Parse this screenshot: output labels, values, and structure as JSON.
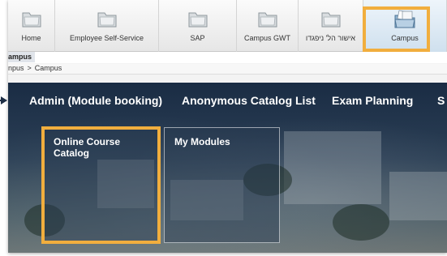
{
  "toolbar": {
    "items": [
      {
        "label": "Home",
        "icon": "folder-icon"
      },
      {
        "label": "Employee Self-Service",
        "icon": "folder-icon"
      },
      {
        "label": "SAP",
        "icon": "folder-icon"
      },
      {
        "label": "Campus GWT",
        "icon": "folder-icon"
      },
      {
        "label": "אישור הל' ניפגדו",
        "icon": "folder-icon"
      },
      {
        "label": "Campus",
        "icon": "folder-open-papers-icon"
      }
    ],
    "active_index": 5
  },
  "page": {
    "subtitle": "ampus",
    "breadcrumb": [
      "npus",
      ">",
      "Campus"
    ]
  },
  "nav": {
    "items": [
      "Admin (Module booking)",
      "Anonymous Catalog List",
      "Exam Planning",
      "S"
    ]
  },
  "tiles": [
    {
      "title": "Online Course Catalog"
    },
    {
      "title": "My Modules"
    }
  ],
  "colors": {
    "highlight": "#f1ae3e",
    "nav_text": "#ffffff",
    "hero_bg": "#1a2c44"
  }
}
